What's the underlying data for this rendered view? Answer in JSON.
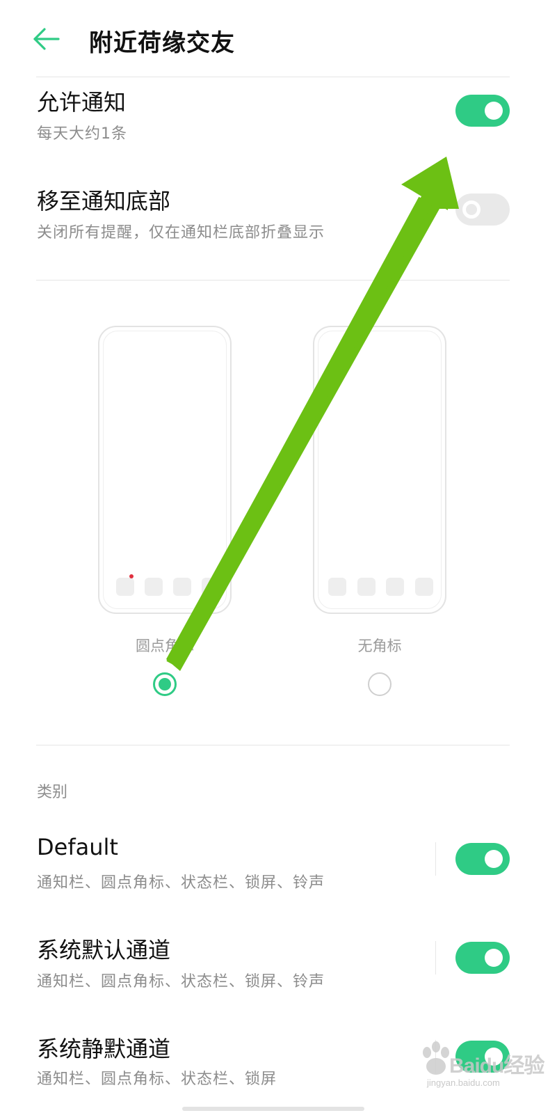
{
  "header": {
    "title": "附近荷缘交友",
    "back_icon": "arrow-left-icon"
  },
  "settings": {
    "allow_notifications": {
      "title": "允许通知",
      "subtitle": "每天大约1条",
      "enabled": true
    },
    "move_to_bottom": {
      "title": "移至通知底部",
      "subtitle": "关闭所有提醒，仅在通知栏底部折叠显示",
      "enabled": false
    }
  },
  "badge_style": {
    "options": [
      {
        "label": "圆点角标",
        "selected": true
      },
      {
        "label": "无角标",
        "selected": false
      }
    ]
  },
  "category": {
    "label": "类别",
    "channels": [
      {
        "title": "Default",
        "subtitle": "通知栏、圆点角标、状态栏、锁屏、铃声",
        "enabled": true
      },
      {
        "title": "系统默认通道",
        "subtitle": "通知栏、圆点角标、状态栏、锁屏、铃声",
        "enabled": true
      },
      {
        "title": "系统静默通道",
        "subtitle": "通知栏、圆点角标、状态栏、锁屏",
        "enabled": true
      }
    ]
  },
  "watermark": {
    "text": "Baidu经验",
    "sub": "jingyan.baidu.com"
  },
  "colors": {
    "accent": "#2fcb85",
    "annotation_arrow": "#6cc014",
    "badge_dot": "#e0303f"
  }
}
